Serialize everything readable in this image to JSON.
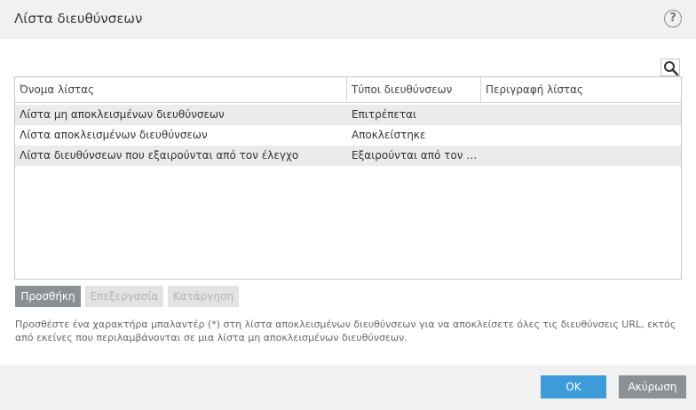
{
  "window": {
    "title": "Λίστα διευθύνσεων",
    "help_glyph": "?"
  },
  "table": {
    "columns": [
      "Όνομα λίστας",
      "Τύποι διευθύνσεων",
      "Περιγραφή λίστας"
    ],
    "rows": [
      {
        "name": "Λίστα μη αποκλεισμένων διευθύνσεων",
        "type": "Επιτρέπεται",
        "description": ""
      },
      {
        "name": "Λίστα αποκλεισμένων διευθύνσεων",
        "type": "Αποκλείστηκε",
        "description": ""
      },
      {
        "name": "Λίστα διευθύνσεων που εξαιρούνται από τον έλεγχο",
        "type": "Εξαιρούνται από τον έλε...",
        "description": ""
      }
    ]
  },
  "actions": {
    "add_label": "Προσθήκη",
    "edit_label": "Επεξεργασία",
    "remove_label": "Κατάργηση"
  },
  "hint": "Προσθέστε ένα χαρακτήρα μπαλαντέρ (*) στη λίστα αποκλεισμένων διευθύνσεων για να αποκλείσετε όλες τις διευθύνσεις URL, εκτός από εκείνες που περιλαμβάνονται σε μια λίστα μη αποκλεισμένων διευθύνσεων.",
  "footer": {
    "ok_label": "OK",
    "cancel_label": "Ακύρωση"
  },
  "colors": {
    "accent": "#3d9bd9",
    "neutral_button": "#8c9094"
  }
}
